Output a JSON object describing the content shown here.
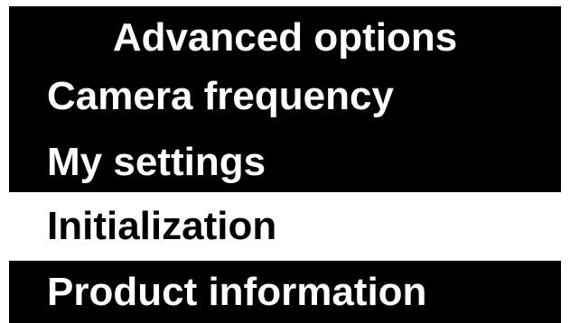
{
  "header": {
    "title": "Advanced options"
  },
  "menu": {
    "items": [
      {
        "label": "Camera frequency",
        "selected": false
      },
      {
        "label": "My settings",
        "selected": false
      },
      {
        "label": "Initialization",
        "selected": true
      },
      {
        "label": "Product information",
        "selected": false
      }
    ]
  },
  "colors": {
    "background": "#000000",
    "text": "#ffffff",
    "selected_background": "#ffffff",
    "selected_text": "#000000"
  }
}
